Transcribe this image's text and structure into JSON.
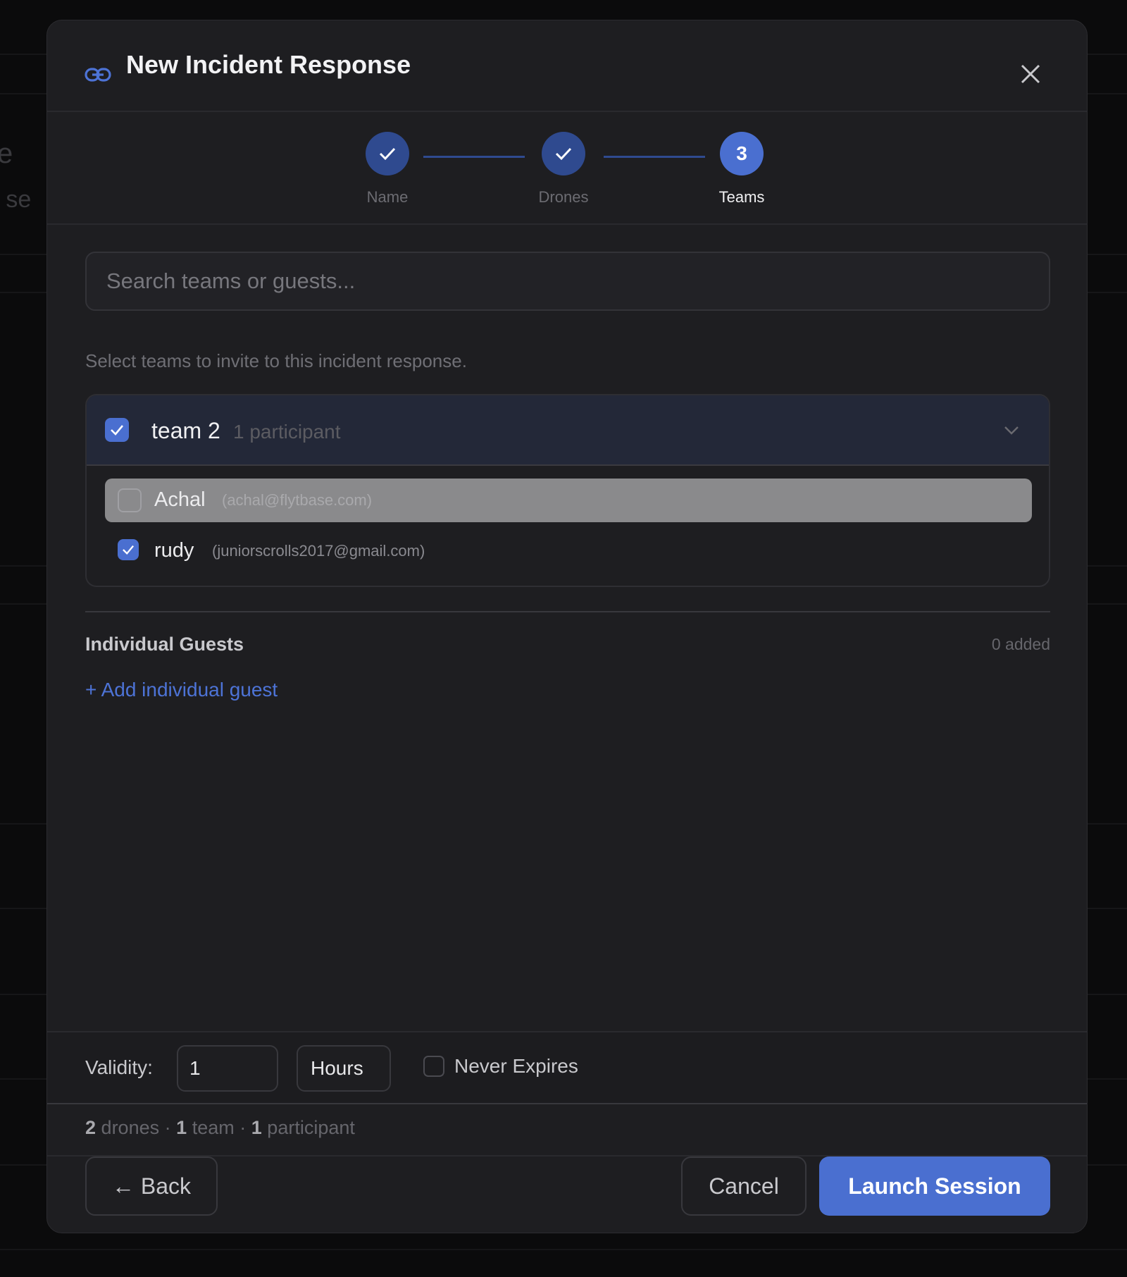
{
  "background": {
    "fragment_1": "e",
    "fragment_2": "e se"
  },
  "modal": {
    "title": "New Incident Response",
    "title_icon": "link-icon",
    "close_icon": "close-icon"
  },
  "stepper": {
    "steps": [
      {
        "label": "Name",
        "state": "complete"
      },
      {
        "label": "Drones",
        "state": "complete"
      },
      {
        "label": "Teams",
        "state": "active",
        "number": "3"
      }
    ]
  },
  "search": {
    "placeholder": "Search teams or guests..."
  },
  "helper_text": "Select teams to invite to this incident response.",
  "teams": [
    {
      "name": "team 2",
      "participants_label": "1 participant",
      "checked": true,
      "expanded": true,
      "members": [
        {
          "name": "Achal",
          "email": "(achal@flytbase.com)",
          "checked": false,
          "highlighted": true
        },
        {
          "name": "rudy",
          "email": "(juniorscrolls2017@gmail.com)",
          "checked": true,
          "highlighted": false
        }
      ]
    }
  ],
  "guests": {
    "title": "Individual Guests",
    "count_label": "0 added",
    "add_label": "+ Add individual guest"
  },
  "validity": {
    "label": "Validity:",
    "value": "1",
    "unit": "Hours",
    "never_expires_label": "Never Expires",
    "never_expires_checked": false
  },
  "summary": {
    "drones_count": "2",
    "drones_word": "drones",
    "sep1": "·",
    "teams_count": "1",
    "teams_word": "team",
    "sep2": "·",
    "participants_count": "1",
    "participants_word": "participant"
  },
  "buttons": {
    "back": "← Back",
    "cancel": "Cancel",
    "launch": "Launch Session"
  },
  "colors": {
    "accent": "#4a6fd0",
    "accent_dim": "#2f4a8f",
    "modal_bg": "#1e1e21",
    "highlight_row": "#8a8a8c"
  }
}
